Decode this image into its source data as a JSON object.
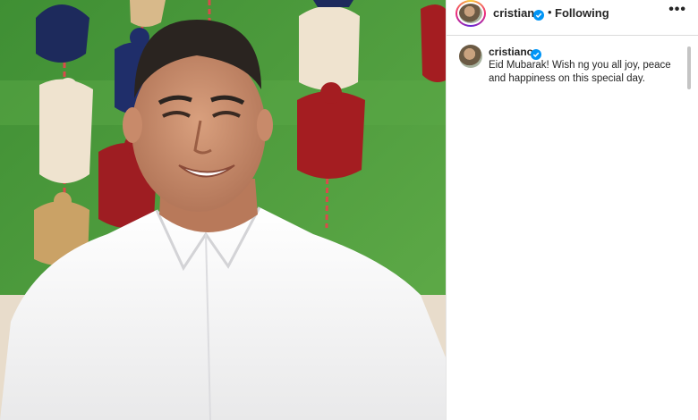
{
  "post": {
    "username": "cristiano",
    "separator": "•",
    "follow_status": "Following",
    "more_menu": "•••",
    "verified_color": "#0095f6",
    "caption": {
      "username": "cristiano",
      "text": "Eid Mubarak! Wish ng you all joy, peace and happiness on this special day."
    }
  },
  "icons": {
    "verified": "verified-badge-icon",
    "more": "more-options-icon"
  }
}
